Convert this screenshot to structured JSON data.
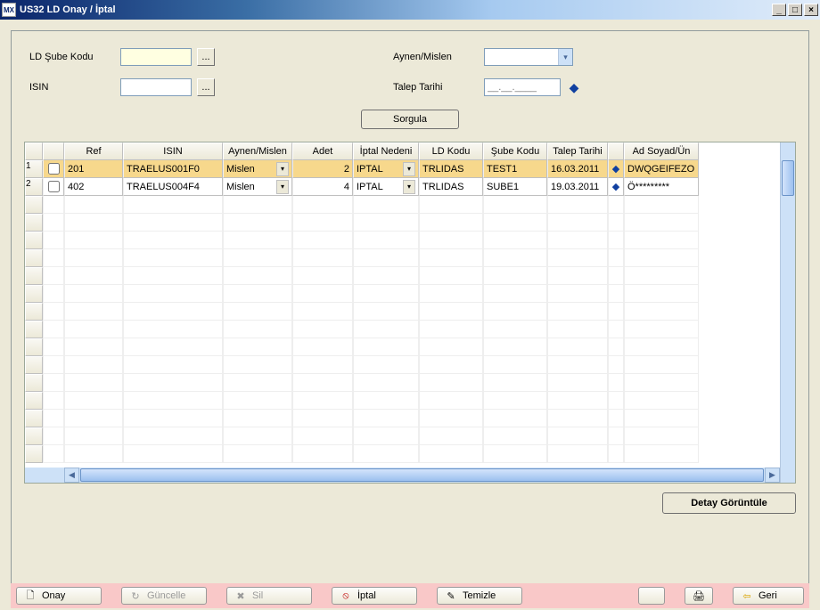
{
  "window": {
    "app_icon_text": "MX",
    "title": "US32 LD Onay / İptal"
  },
  "form": {
    "ld_sube_kodu_label": "LD Şube Kodu",
    "ld_sube_kodu_value": "",
    "lookup_label": "...",
    "isin_label": "ISIN",
    "isin_value": "",
    "aynen_mislen_label": "Aynen/Mislen",
    "aynen_mislen_value": "",
    "talep_tarihi_label": "Talep Tarihi",
    "talep_tarihi_value": "__.__.____",
    "sorgula_label": "Sorgula"
  },
  "grid": {
    "columns": {
      "ref": "Ref",
      "isin": "ISIN",
      "aynen_mislen": "Aynen/Mislen",
      "adet": "Adet",
      "iptal_nedeni": "İptal Nedeni",
      "ld_kodu": "LD Kodu",
      "sube_kodu": "Şube Kodu",
      "talep_tarihi": "Talep Tarihi",
      "ad_soyad": "Ad Soyad/Ün"
    },
    "rows": [
      {
        "num": "1",
        "checked": false,
        "ref": "201",
        "isin": "TRAELUS001F0",
        "aynen_mislen": "Mislen",
        "adet": "2",
        "iptal_nedeni": "IPTAL",
        "ld_kodu": "TRLIDAS",
        "sube_kodu": "TEST1",
        "talep_tarihi": "16.03.2011",
        "ad_soyad": "DWQGEIFEZO",
        "selected": true
      },
      {
        "num": "2",
        "checked": false,
        "ref": "402",
        "isin": "TRAELUS004F4",
        "aynen_mislen": "Mislen",
        "adet": "4",
        "iptal_nedeni": "IPTAL",
        "ld_kodu": "TRLIDAS",
        "sube_kodu": "SUBE1",
        "talep_tarihi": "19.03.2011",
        "ad_soyad": "Ö*********",
        "selected": false
      }
    ]
  },
  "detay_label": "Detay Görüntüle",
  "buttons": {
    "onay": "Onay",
    "guncelle": "Güncelle",
    "sil": "Sil",
    "iptal": "İptal",
    "temizle": "Temizle",
    "geri": "Geri"
  },
  "icons": {
    "onay": "🗋",
    "guncelle": "↻",
    "sil": "✖",
    "iptal": "⦸",
    "temizle": "✎",
    "print": "🖨",
    "geri_arrow": "⇦",
    "calendar": "◆",
    "dd": "▾"
  },
  "colors": {
    "sil_icon": "#888888",
    "iptal_icon": "#c00000",
    "geri_icon": "#d9a400"
  }
}
